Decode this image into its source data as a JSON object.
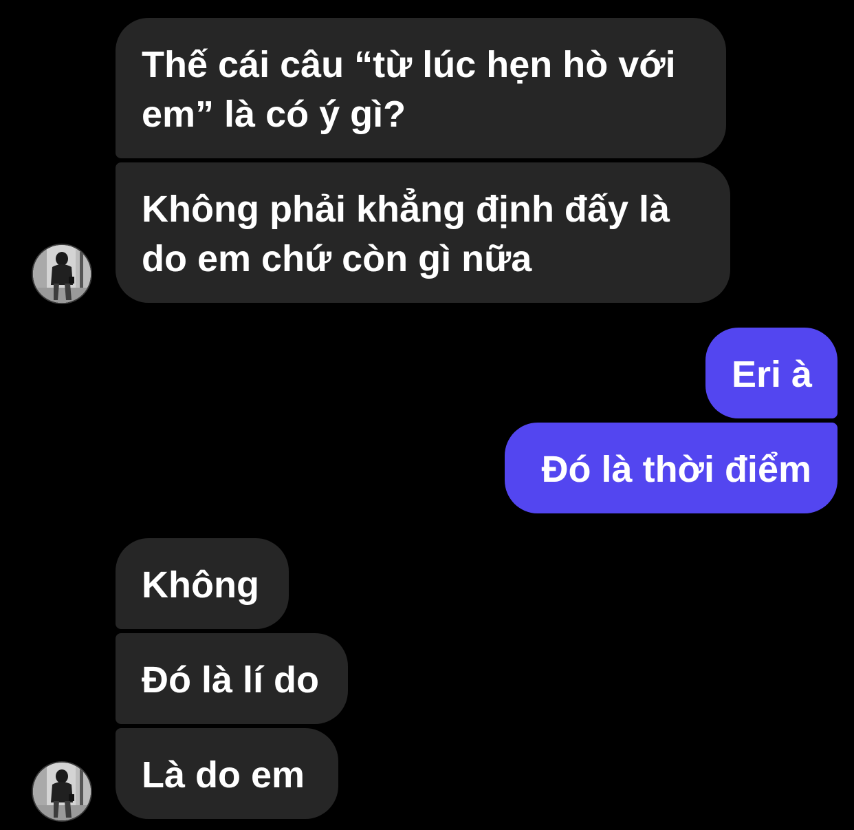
{
  "conversation": {
    "messages": [
      {
        "sender": "them",
        "text_lines": [
          "Thế cái câu “từ lúc hẹn hò với",
          "em” là có ý gì?"
        ]
      },
      {
        "sender": "them",
        "text_lines": [
          "Không phải khẳng định đấy là",
          "do em chứ còn gì nữa"
        ]
      },
      {
        "sender": "me",
        "text": "Eri à"
      },
      {
        "sender": "me",
        "text": "Đó là thời điểm"
      },
      {
        "sender": "them",
        "text": "Không"
      },
      {
        "sender": "them",
        "text": "Đó là lí do"
      },
      {
        "sender": "them",
        "text": "Là do em"
      }
    ]
  },
  "colors": {
    "background": "#000000",
    "incoming_bubble": "#262626",
    "outgoing_bubble": "#5346f0",
    "text": "#ffffff"
  },
  "icons": {
    "avatar": "contact-avatar-photo"
  }
}
